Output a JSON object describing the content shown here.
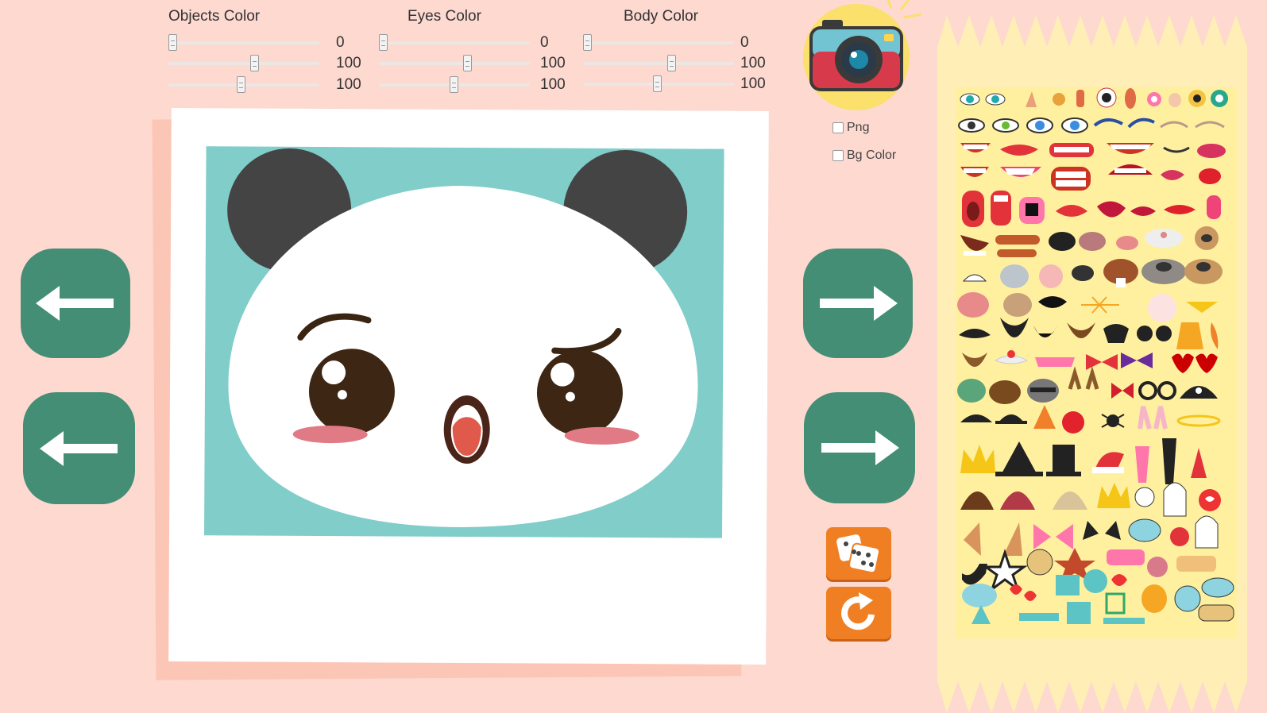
{
  "controls": [
    {
      "name": "objects",
      "title": "Objects Color",
      "values": [
        "0",
        "100",
        "100"
      ],
      "levels": [
        0,
        59,
        49
      ]
    },
    {
      "name": "eyes",
      "title": "Eyes Color",
      "values": [
        "0",
        "100",
        "100"
      ],
      "levels": [
        0,
        58,
        49
      ]
    },
    {
      "name": "body",
      "title": "Body Color",
      "values": [
        "0",
        "100",
        "100"
      ],
      "levels": [
        0,
        59,
        49
      ]
    }
  ],
  "options": {
    "png_label": "Png",
    "bg_color_label": "Bg Color"
  },
  "buttons": {
    "left_1": "arrow-left-icon",
    "left_2": "arrow-left-icon",
    "right_1": "arrow-right-icon",
    "right_2": "arrow-right-icon",
    "random": "dice-icon",
    "reset": "refresh-icon",
    "camera": "camera-icon"
  },
  "colors": {
    "background": "#fdd9d0",
    "nav_button": "#438e74",
    "action_button": "#ef7f22",
    "canvas_bg": "#80cdc9",
    "panel": "#ffeeb5",
    "panda_ears": "#444444"
  },
  "palette_icons": [
    "eyes",
    "nose",
    "mouth",
    "lips",
    "teeth",
    "animal-nose",
    "mustache",
    "beard",
    "glasses",
    "bow-tie",
    "heart-glasses",
    "animal-face",
    "ears",
    "hat",
    "crown",
    "party-hat",
    "hair",
    "elf-ears",
    "cat-ears",
    "speech-bubble",
    "shape",
    "pipe",
    "star"
  ]
}
